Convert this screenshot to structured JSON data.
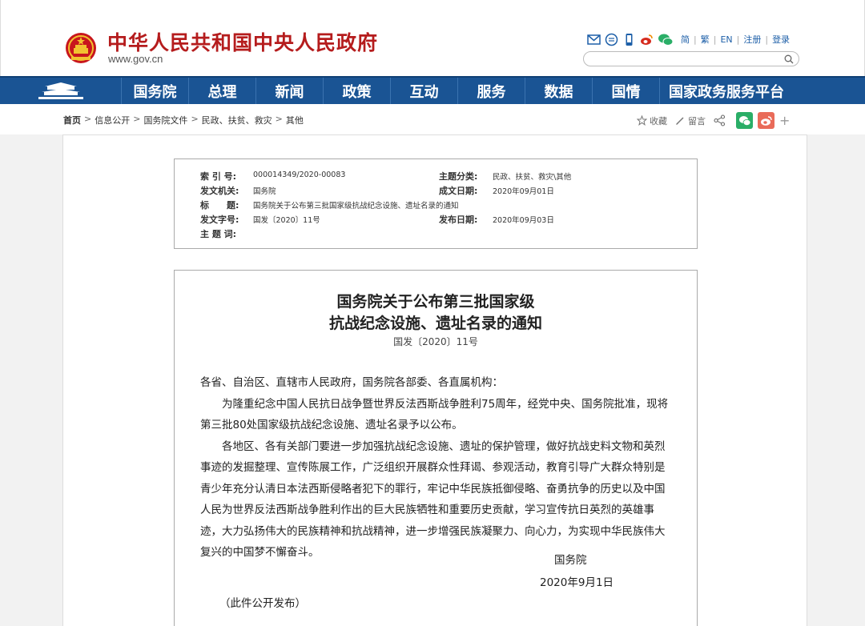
{
  "header": {
    "site_title": "中华人民共和国中央人民政府",
    "site_url": "www.gov.cn",
    "links": [
      "简",
      "繁",
      "EN",
      "注册",
      "登录"
    ],
    "search_placeholder": ""
  },
  "nav": {
    "items": [
      "国务院",
      "总理",
      "新闻",
      "政策",
      "互动",
      "服务",
      "数据",
      "国情",
      "国家政务服务平台"
    ]
  },
  "breadcrumb": {
    "items": [
      "首页",
      "信息公开",
      "国务院文件",
      "民政、扶贫、救灾",
      "其他"
    ]
  },
  "tools": {
    "favorite": "收藏",
    "comment": "留言"
  },
  "meta": {
    "index_no_label": "索 引 号:",
    "index_no": "000014349/2020-00083",
    "topic_label": "主题分类:",
    "topic": "民政、扶贫、救灾\\其他",
    "issuer_label": "发文机关:",
    "issuer": "国务院",
    "written_date_label": "成文日期:",
    "written_date": "2020年09月01日",
    "title_label": "标　　题:",
    "title": "国务院关于公布第三批国家级抗战纪念设施、遗址名录的通知",
    "doc_no_label": "发文字号:",
    "doc_no": "国发〔2020〕11号",
    "publish_date_label": "发布日期:",
    "publish_date": "2020年09月03日",
    "keywords_label": "主 题 词:",
    "keywords": ""
  },
  "document": {
    "title_line1": "国务院关于公布第三批国家级",
    "title_line2": "抗战纪念设施、遗址名录的通知",
    "number": "国发〔2020〕11号",
    "salutation": "各省、自治区、直辖市人民政府，国务院各部委、各直属机构：",
    "para1": "为隆重纪念中国人民抗日战争暨世界反法西斯战争胜利75周年，经党中央、国务院批准，现将第三批80处国家级抗战纪念设施、遗址名录予以公布。",
    "para2": "各地区、各有关部门要进一步加强抗战纪念设施、遗址的保护管理，做好抗战史料文物和英烈事迹的发掘整理、宣传陈展工作，广泛组织开展群众性拜谒、参观活动，教育引导广大群众特别是青少年充分认清日本法西斯侵略者犯下的罪行，牢记中华民族抵御侵略、奋勇抗争的历史以及中国人民为世界反法西斯战争胜利作出的巨大民族牺牲和重要历史贡献，学习宣传抗日英烈的英雄事迹，大力弘扬伟大的民族精神和抗战精神，进一步增强民族凝聚力、向心力，为实现中华民族伟大复兴的中国梦不懈奋斗。",
    "signature": "国务院",
    "date": "2020年9月1日",
    "note": "（此件公开发布）"
  },
  "colors": {
    "brand_red": "#b51c1d",
    "nav_blue": "#1a5494",
    "wechat_green": "#2aae67",
    "weibo_red": "#e96b59"
  }
}
